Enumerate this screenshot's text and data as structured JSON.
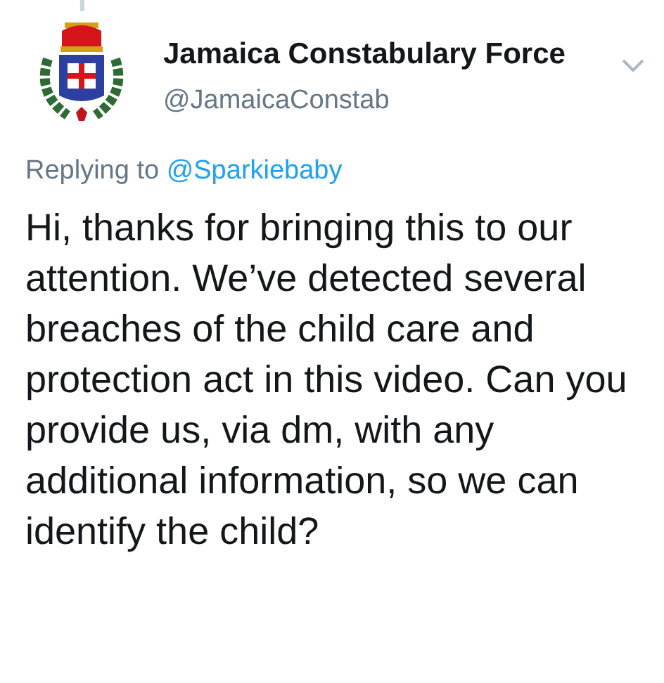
{
  "tweet": {
    "author_name": "Jamaica Constabulary Force",
    "handle": "@JamaicaConstab",
    "reply_prefix": "Replying to",
    "reply_to": "@Sparkiebaby",
    "text": "Hi, thanks for bringing this to our attention. We’ve detected several breaches of the child care and protection act in this video. Can you provide us, via dm, with any additional information, so we can identify the child?"
  }
}
